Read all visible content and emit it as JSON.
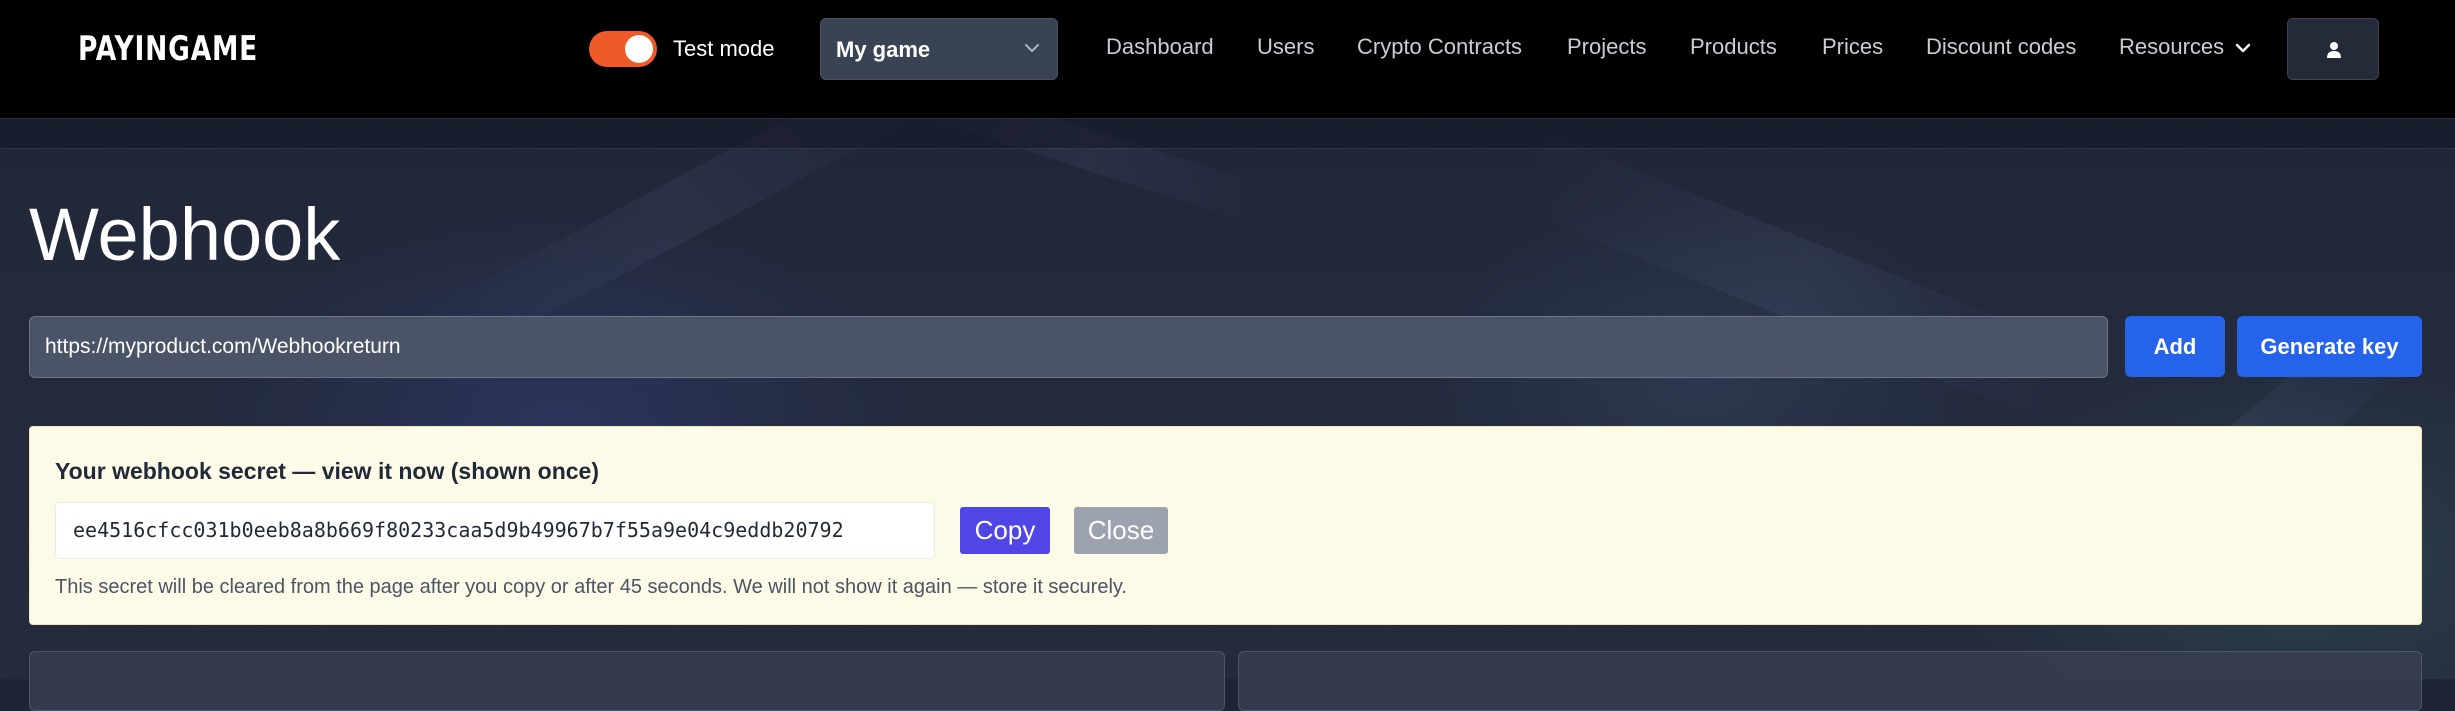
{
  "navbar": {
    "logo": "PAYINGAME",
    "test_mode": {
      "label": "Test mode",
      "enabled": true,
      "color": "#f05a28"
    },
    "game_select": {
      "selected": "My game"
    },
    "links": [
      "Dashboard",
      "Users",
      "Crypto Contracts",
      "Projects",
      "Products",
      "Prices",
      "Discount codes",
      "Resources"
    ]
  },
  "page": {
    "title": "Webhook"
  },
  "webhook_form": {
    "url_value": "https://myproduct.com/Webhookreturn",
    "add_label": "Add",
    "generate_label": "Generate key"
  },
  "secret_panel": {
    "heading": "Your webhook secret — view it now (shown once)",
    "secret": "ee4516cfcc031b0eeb8a8b669f80233caa5d9b49967b7f55a9e04c9eddb20792",
    "copy_label": "Copy",
    "close_label": "Close",
    "note": "This secret will be cleared from the page after you copy or after 45 seconds. We will not show it again — store it securely."
  },
  "colors": {
    "primary_button": "#2563eb",
    "copy_button": "#4f46e5",
    "close_button": "#9ca3af",
    "secret_background": "#fefae8",
    "navbar_background": "#000000"
  },
  "icons": {
    "select_chevron": "chevron-down-icon",
    "resources_chevron": "chevron-down-icon",
    "user": "user-icon"
  }
}
